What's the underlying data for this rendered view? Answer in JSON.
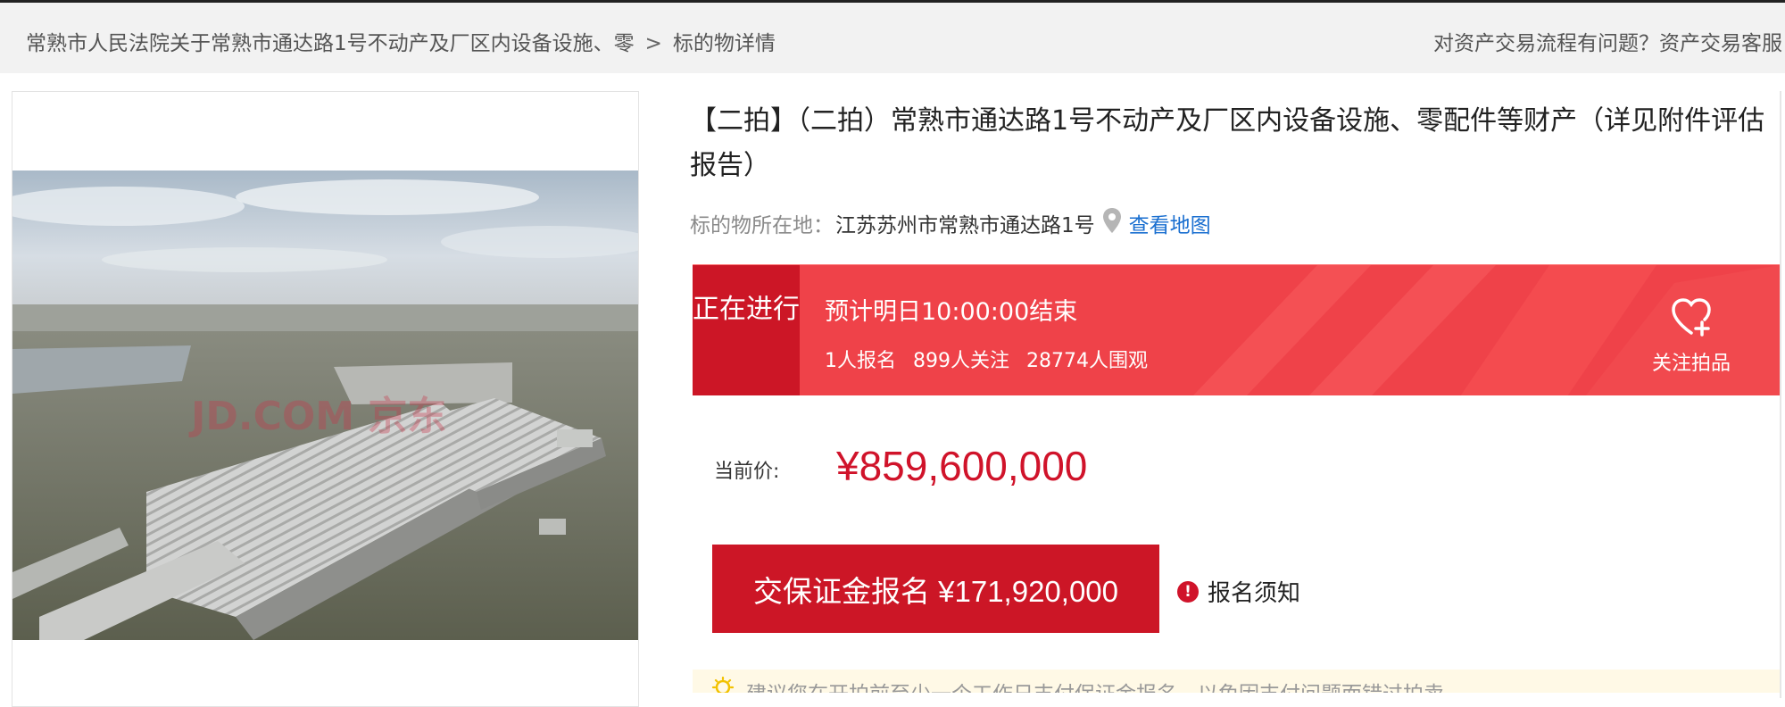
{
  "breadcrumb": {
    "parent": "常熟市人民法院关于常熟市通达路1号不动产及厂区内设备设施、零",
    "separator": ">",
    "current": "标的物详情"
  },
  "help_link": "对资产交易流程有问题？资产交易客服",
  "photo": {
    "watermark": "JD.COM 京东"
  },
  "title": "【二拍】（二拍）常熟市通达路1号不动产及厂区内设备设施、零配件等财产（详见附件评估报告）",
  "location": {
    "label": "标的物所在地：",
    "address": "江苏苏州市常熟市通达路1号",
    "map_link": "查看地图",
    "icon": "map-pin-icon"
  },
  "status": {
    "tag": "正在进行",
    "end_time": "预计明日10:00:00结束",
    "signups": "1人报名",
    "followers": "899人关注",
    "viewers": "28774人围观",
    "follow_label": "关注拍品",
    "follow_icon": "heart-plus-icon"
  },
  "price": {
    "label": "当前价:",
    "value": "¥859,600,000"
  },
  "deposit_button": "交保证金报名 ¥171,920,000",
  "notice": {
    "label": "报名须知",
    "icon": "alert-icon"
  },
  "tip": {
    "icon": "lightbulb-icon",
    "text": "建议您在开拍前至少一个工作日支付保证金报名，以免因支付问题而错过拍卖。"
  },
  "colors": {
    "brand_red": "#cc1626",
    "banner_red": "#f0444a",
    "price_red": "#d0132a",
    "link_blue": "#1a6fd0"
  }
}
